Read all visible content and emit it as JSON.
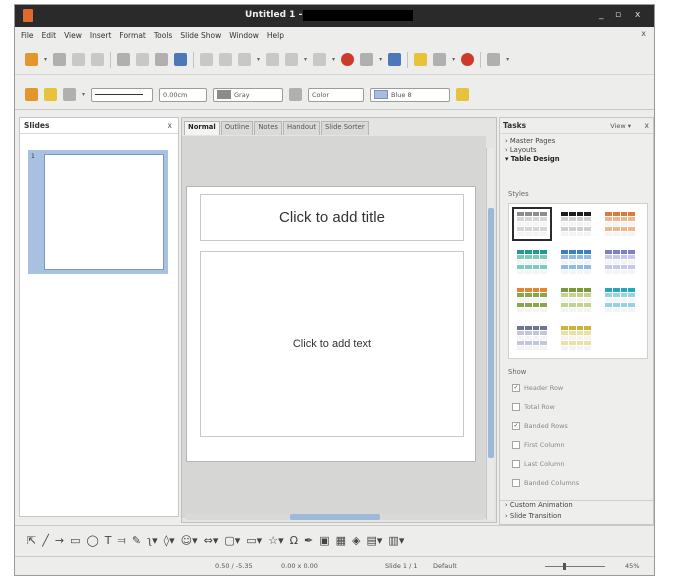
{
  "window": {
    "title": "Untitled 1 -",
    "controls": [
      "_",
      "▫",
      "x"
    ]
  },
  "menubar": {
    "items": [
      "File",
      "Edit",
      "View",
      "Insert",
      "Format",
      "Tools",
      "Slide Show",
      "Window",
      "Help"
    ],
    "close": "x"
  },
  "toolbar2": {
    "line_width": "0.00cm",
    "line_color": "Gray",
    "fill_type": "Color",
    "fill_color": "Blue 8",
    "colors": {
      "gray": "#8c8c8c",
      "blue": "#a8bbe0"
    }
  },
  "slides_pane": {
    "title": "Slides",
    "close": "x",
    "slide_number": "1"
  },
  "view_tabs": [
    "Normal",
    "Outline",
    "Notes",
    "Handout",
    "Slide Sorter"
  ],
  "slide": {
    "title_placeholder": "Click to add title",
    "body_placeholder": "Click to add text"
  },
  "tasks_pane": {
    "title": "Tasks",
    "view": "View",
    "close": "x",
    "sections": [
      "Master Pages",
      "Layouts",
      "Table Design"
    ],
    "styles_label": "Styles",
    "show_label": "Show",
    "options": [
      {
        "label": "Header Row",
        "checked": true
      },
      {
        "label": "Total Row",
        "checked": false
      },
      {
        "label": "Banded Rows",
        "checked": true
      },
      {
        "label": "First Column",
        "checked": false
      },
      {
        "label": "Last Column",
        "checked": false
      },
      {
        "label": "Banded Columns",
        "checked": false
      }
    ],
    "bottom_sections": [
      "Custom Animation",
      "Slide Transition"
    ],
    "table_styles": [
      {
        "name": "style-default",
        "colors": [
          "#8d8d8d",
          "#d6d6d6"
        ]
      },
      {
        "name": "style-black",
        "colors": [
          "#1d1d1d",
          "#cfcfcf"
        ]
      },
      {
        "name": "style-orange",
        "colors": [
          "#e2773a",
          "#f1b58b"
        ]
      },
      {
        "name": "style-teal",
        "colors": [
          "#1f9c8f",
          "#79cdbf"
        ]
      },
      {
        "name": "style-blue",
        "colors": [
          "#3b7fc4",
          "#8fbbe6"
        ]
      },
      {
        "name": "style-lavender",
        "colors": [
          "#7d7fc9",
          "#c5c7ec"
        ]
      },
      {
        "name": "style-orange-green",
        "colors": [
          "#e7842f",
          "#8aa64a"
        ]
      },
      {
        "name": "style-olive",
        "colors": [
          "#7a9a3a",
          "#c2d38f"
        ]
      },
      {
        "name": "style-cyan",
        "colors": [
          "#25a7c4",
          "#96d3e2"
        ]
      },
      {
        "name": "style-slate",
        "colors": [
          "#6f7594",
          "#c3c6d8"
        ]
      },
      {
        "name": "style-yellow",
        "colors": [
          "#cbb33a",
          "#ece1a2"
        ]
      }
    ]
  },
  "statusbar": {
    "position": "0.50 / -5.35",
    "size": "0.00 x 0.00",
    "slide": "Slide 1 / 1",
    "layout": "Default",
    "zoom": "45%"
  }
}
